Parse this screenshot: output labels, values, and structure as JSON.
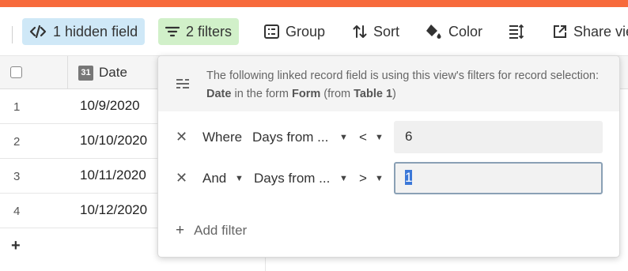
{
  "toolbar": {
    "hidden_fields_label": "1 hidden field",
    "filters_label": "2 filters",
    "group_label": "Group",
    "sort_label": "Sort",
    "color_label": "Color",
    "share_label": "Share vie"
  },
  "grid": {
    "date_column_label": "Date",
    "calendar_icon_text": "31",
    "rows": [
      {
        "num": "1",
        "date": "10/9/2020"
      },
      {
        "num": "2",
        "date": "10/10/2020"
      },
      {
        "num": "3",
        "date": "10/11/2020"
      },
      {
        "num": "4",
        "date": "10/12/2020"
      }
    ],
    "add_row": "+"
  },
  "filter_popover": {
    "info_prefix": "The following linked record field is using this view's filters for record selection: ",
    "info_field": "Date",
    "info_mid1": " in the form ",
    "info_form": "Form",
    "info_mid2": " (from ",
    "info_table": "Table 1",
    "info_end": ")",
    "filters": [
      {
        "conjunction": "Where",
        "field": "Days from ...",
        "operator": "<",
        "value": "6"
      },
      {
        "conjunction": "And",
        "field": "Days from ...",
        "operator": ">",
        "value": "1"
      }
    ],
    "add_filter_label": "Add filter"
  },
  "colors": {
    "top_accent": "#f76a3c",
    "hidden_field_bg": "#cfe8f7",
    "filters_bg": "#d1f0c9",
    "selection": "#3c78d8"
  }
}
